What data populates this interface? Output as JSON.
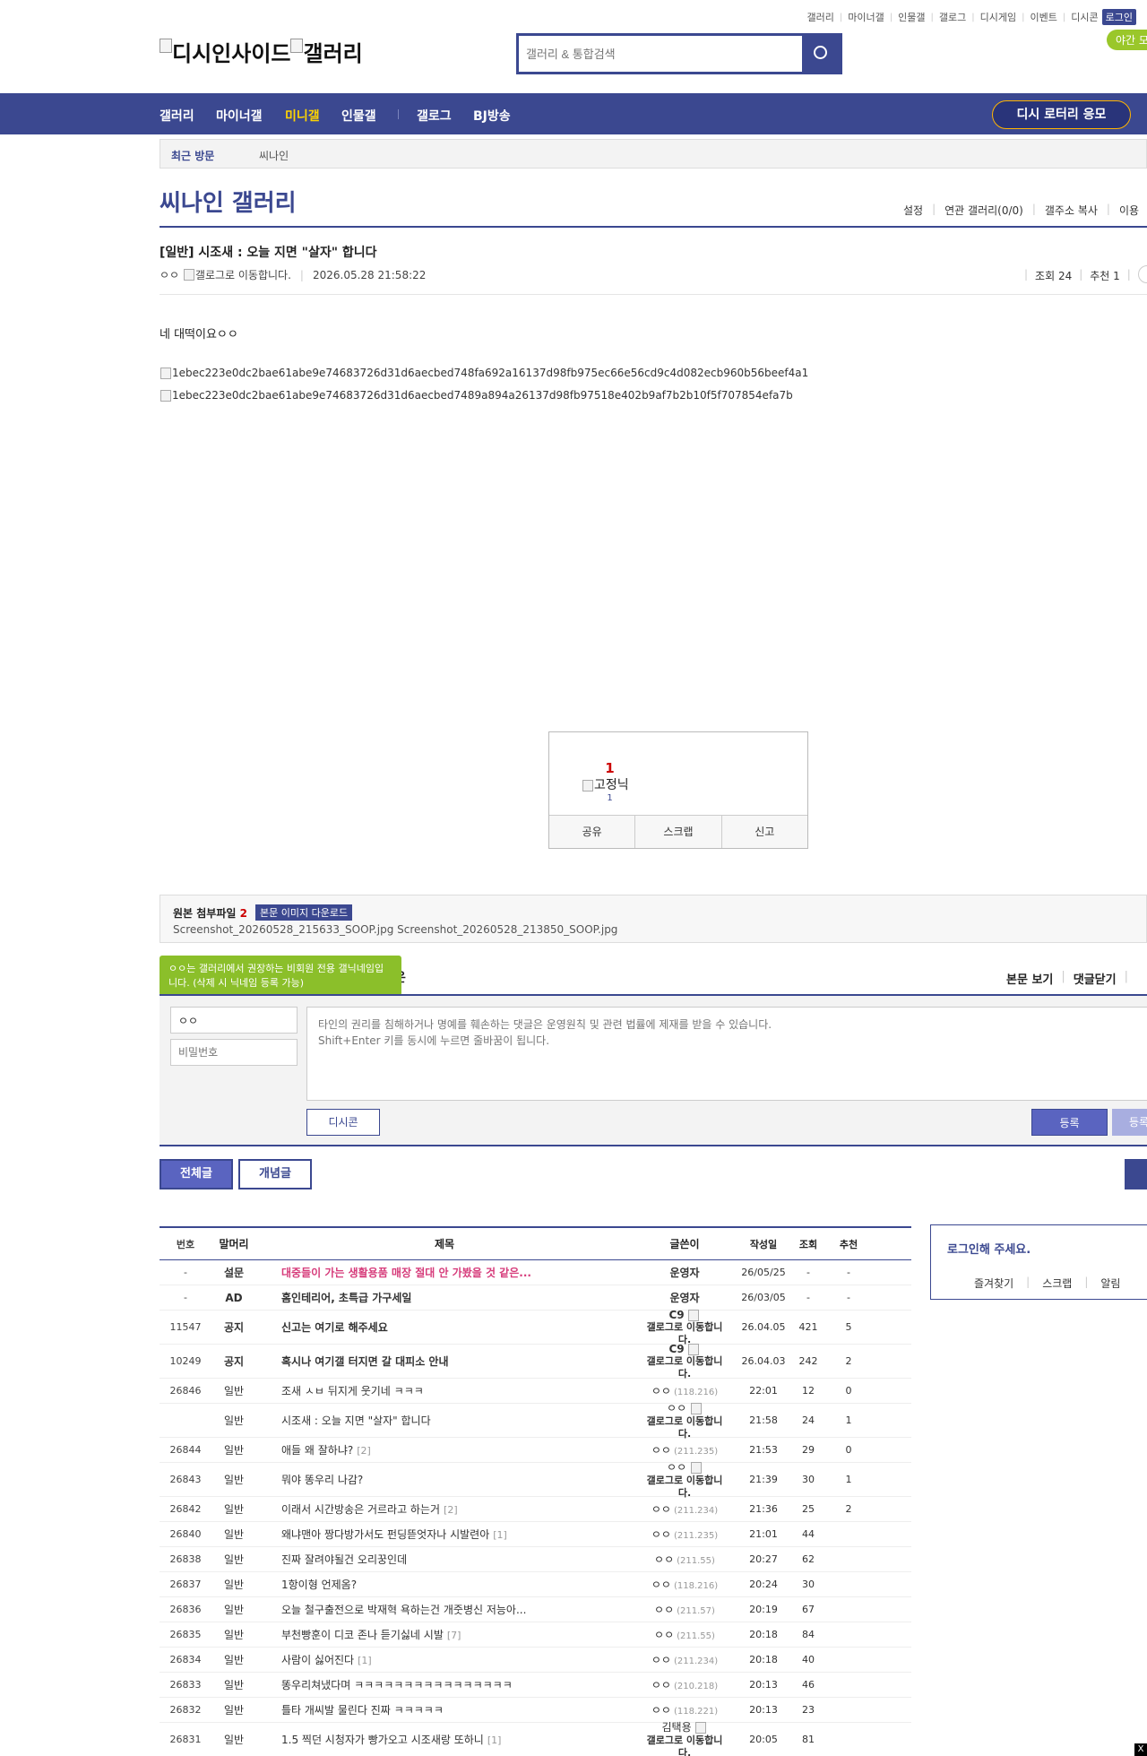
{
  "header": {
    "top_links": [
      "갤러리",
      "마이너갤",
      "인물갤",
      "갤로그",
      "디시게임",
      "이벤트",
      "디시콘"
    ],
    "login": "로그인",
    "night_mode": "야간 모",
    "logo_text": "디시인사이드",
    "logo_sub": "갤러리",
    "search_placeholder": "갤러리 & 통합검색"
  },
  "nav": {
    "items": [
      "갤러리",
      "마이너갤",
      "미니갤",
      "인물갤",
      "갤로그",
      "BJ방송"
    ],
    "active": "미니갤",
    "lottery": "디시 로터리 응모"
  },
  "recent": {
    "label": "최근 방문",
    "item": "씨나인"
  },
  "gallery": {
    "title": "씨나인 갤러리",
    "tools": [
      "설정",
      "연관 갤러리(0/0)",
      "갤주소 복사",
      "이용"
    ]
  },
  "post": {
    "title": "[일반] 시조새 : 오늘 지면 \"살자\" 합니다",
    "writer": "ㅇㅇ",
    "writer_alt": "갤로그로 이동합니다.",
    "date": "2026.05.28 21:58:22",
    "views": "조회 24",
    "recommend": "추천 1",
    "body": "네 대떡이요ㅇㅇ",
    "images": [
      "1ebec223e0dc2bae61abe9e74683726d31d6aecbed748fa692a16137d98fb975ec66e56cd9c4d082ecb960b56beef4a1",
      "1ebec223e0dc2bae61abe9e74683726d31d6aecbed7489a894a26137d98fb97518e402b9af7b2b10f5f707854efa7b"
    ]
  },
  "recommend_box": {
    "count": "1",
    "label": "고정닉",
    "sub": "1",
    "buttons": [
      "공유",
      "스크랩",
      "신고"
    ]
  },
  "attachments": {
    "label": "원본 첨부파일",
    "count": "2",
    "download": "본문 이미지 다운로드",
    "files": "Screenshot_20260528_215633_SOOP.jpg  Screenshot_20260528_213850_SOOP.jpg"
  },
  "comments": {
    "title_fragment": "은",
    "tooltip": "ㅇㅇ는 갤러리에서 권장하는 비회원 전용 갤닉네임입니다. (삭제 시 닉네임 등록 가능)",
    "links": [
      "본문 보기",
      "댓글닫기"
    ],
    "nick": "ㅇㅇ",
    "password_placeholder": "비밀번호",
    "textarea_placeholder": "타인의 권리를 침해하거나 명예를 훼손하는 댓글은 운영원칙 및 관련 법률에 제재를 받을 수 있습니다.\nShift+Enter 키를 동시에 누르면 줄바꿈이 됩니다.",
    "dccon": "디시콘",
    "register": "등록",
    "register2": "등록"
  },
  "tabs": {
    "all": "전체글",
    "concept": "개념글"
  },
  "list": {
    "headers": [
      "번호",
      "말머리",
      "제목",
      "글쓴이",
      "작성일",
      "조회",
      "추천"
    ],
    "rows": [
      {
        "no": "-",
        "head": "설문",
        "title": "대중들이 가는 생활용품 매장 절대 안 가봤을 것 같은...",
        "reply": "",
        "writer": "운영자",
        "ip": "",
        "date": "26/05/25",
        "views": "-",
        "rec": "-",
        "style": "pink"
      },
      {
        "no": "-",
        "head": "AD",
        "title": "홈인테리어, 초특급 가구세일",
        "reply": "",
        "writer": "운영자",
        "ip": "",
        "date": "26/03/05",
        "views": "-",
        "rec": "-",
        "style": "bold"
      },
      {
        "no": "11547",
        "head": "공지",
        "title": "신고는 여기로 해주세요",
        "reply": "",
        "writer": "C9",
        "writer_img": "갤로그로 이동합니다.",
        "ip": "",
        "date": "26.04.05",
        "views": "421",
        "rec": "5",
        "style": "bold"
      },
      {
        "no": "10249",
        "head": "공지",
        "title": "혹시나 여기갤 터지면 갈 대피소 안내",
        "reply": "",
        "writer": "C9",
        "writer_img": "갤로그로 이동합니다.",
        "ip": "",
        "date": "26.04.03",
        "views": "242",
        "rec": "2",
        "style": "bold"
      },
      {
        "no": "26846",
        "head": "일반",
        "title": "조새 ㅅㅂ 뒤지게 웃기네 ㅋㅋㅋ",
        "reply": "",
        "writer": "ㅇㅇ",
        "ip": "(118.216)",
        "date": "22:01",
        "views": "12",
        "rec": "0",
        "style": ""
      },
      {
        "no": "",
        "head": "일반",
        "title": "시조새 : 오늘 지면 \"살자\" 합니다",
        "reply": "",
        "writer": "ㅇㅇ",
        "writer_img": "갤로그로 이동합니다.",
        "ip": "",
        "date": "21:58",
        "views": "24",
        "rec": "1",
        "style": ""
      },
      {
        "no": "26844",
        "head": "일반",
        "title": "애들 왜 잘하냐?",
        "reply": "[2]",
        "writer": "ㅇㅇ",
        "ip": "(211.235)",
        "date": "21:53",
        "views": "29",
        "rec": "0",
        "style": ""
      },
      {
        "no": "26843",
        "head": "일반",
        "title": "뭐야 똥우리 나감?",
        "reply": "",
        "writer": "ㅇㅇ",
        "writer_img": "갤로그로 이동합니다.",
        "ip": "",
        "date": "21:39",
        "views": "30",
        "rec": "1",
        "style": ""
      },
      {
        "no": "26842",
        "head": "일반",
        "title": "이래서 시간방송은 거르라고 하는거",
        "reply": "[2]",
        "writer": "ㅇㅇ",
        "ip": "(211.234)",
        "date": "21:36",
        "views": "25",
        "rec": "2",
        "style": ""
      },
      {
        "no": "26840",
        "head": "일반",
        "title": "왜냐맨아 짱다방가서도 펀딩뜯엇자나 시발련아",
        "reply": "[1]",
        "writer": "ㅇㅇ",
        "ip": "(211.235)",
        "date": "21:01",
        "views": "44",
        "rec": "",
        "style": ""
      },
      {
        "no": "26838",
        "head": "일반",
        "title": "진짜 잘려야될건 오리꿍인데",
        "reply": "",
        "writer": "ㅇㅇ",
        "ip": "(211.55)",
        "date": "20:27",
        "views": "62",
        "rec": "",
        "style": ""
      },
      {
        "no": "26837",
        "head": "일반",
        "title": "1항이형 언제옴?",
        "reply": "",
        "writer": "ㅇㅇ",
        "ip": "(118.216)",
        "date": "20:24",
        "views": "30",
        "rec": "",
        "style": ""
      },
      {
        "no": "26836",
        "head": "일반",
        "title": "오늘 철구출전으로 박재혁 욕하는건 개줏병신 저능아...",
        "reply": "",
        "writer": "ㅇㅇ",
        "ip": "(211.57)",
        "date": "20:19",
        "views": "67",
        "rec": "",
        "style": ""
      },
      {
        "no": "26835",
        "head": "일반",
        "title": "부천빵훈이 디코 존나 듣기싫네 시발",
        "reply": "[7]",
        "writer": "ㅇㅇ",
        "ip": "(211.55)",
        "date": "20:18",
        "views": "84",
        "rec": "",
        "style": ""
      },
      {
        "no": "26834",
        "head": "일반",
        "title": "사람이 싫어진다",
        "reply": "[1]",
        "writer": "ㅇㅇ",
        "ip": "(211.234)",
        "date": "20:18",
        "views": "40",
        "rec": "",
        "style": ""
      },
      {
        "no": "26833",
        "head": "일반",
        "title": "똥우리쳐냈다며 ㅋㅋㅋㅋㅋㅋㅋㅋㅋㅋㅋㅋㅋㅋㅋㅋ",
        "reply": "",
        "writer": "ㅇㅇ",
        "ip": "(210.218)",
        "date": "20:13",
        "views": "46",
        "rec": "",
        "style": ""
      },
      {
        "no": "26832",
        "head": "일반",
        "title": "틀타 개씨발 물린다 진짜 ㅋㅋㅋㅋㅋ",
        "reply": "",
        "writer": "ㅇㅇ",
        "ip": "(118.221)",
        "date": "20:13",
        "views": "23",
        "rec": "",
        "style": ""
      },
      {
        "no": "26831",
        "head": "일반",
        "title": "1.5 찍던 시청자가 빵가오고 시조새랑 또하니",
        "reply": "[1]",
        "writer": "김택용",
        "writer_img": "갤로그로 이동합니다.",
        "ip": "",
        "date": "20:05",
        "views": "81",
        "rec": "",
        "style": ""
      }
    ]
  },
  "side": {
    "message": "로그인해 주세요.",
    "links": [
      "즐겨찾기",
      "스크랩",
      "알림"
    ]
  },
  "close": "X",
  "colors": {
    "brand": "#3b4890",
    "accent": "#ffd400",
    "green": "#8bbf2a",
    "pink": "#d63b7a"
  }
}
